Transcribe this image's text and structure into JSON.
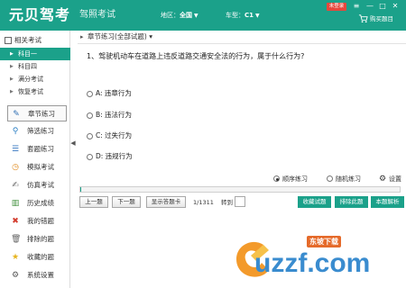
{
  "header": {
    "logo": "元贝驾考",
    "subtitle": "驾照考试",
    "region_label": "地区：",
    "region_value": "全国",
    "car_label": "车型：",
    "car_value": "C1",
    "badge": "未登录",
    "cart_label": "购买题目",
    "colors": {
      "primary": "#1ba18a",
      "badge": "#e6473c"
    }
  },
  "sidebar": {
    "tree_title": "相关考试",
    "tree_items": [
      {
        "label": "科目一",
        "selected": true
      },
      {
        "label": "科目四",
        "selected": false
      },
      {
        "label": "满分考试",
        "selected": false
      },
      {
        "label": "恢复考试",
        "selected": false
      }
    ],
    "menu": [
      {
        "label": "章节练习",
        "icon": "pencil-icon",
        "active": true
      },
      {
        "label": "筛选练习",
        "icon": "magnifier-icon",
        "active": false
      },
      {
        "label": "套题练习",
        "icon": "list-icon",
        "active": false
      },
      {
        "label": "模拟考试",
        "icon": "clock-icon",
        "active": false
      },
      {
        "label": "仿真考试",
        "icon": "pen-icon",
        "active": false
      },
      {
        "label": "历史成绩",
        "icon": "chart-icon",
        "active": false
      },
      {
        "label": "我的错题",
        "icon": "cross-icon",
        "active": false
      },
      {
        "label": "排除的题",
        "icon": "trash-icon",
        "active": false
      },
      {
        "label": "收藏的题",
        "icon": "star-icon",
        "active": false
      },
      {
        "label": "系统设置",
        "icon": "gear-icon",
        "active": false
      }
    ]
  },
  "main": {
    "breadcrumb": "章节练习(全部试题)",
    "question": "1、驾驶机动车在道路上违反道路交通安全法的行为，属于什么行为?",
    "options": [
      "A: 违章行为",
      "B: 违法行为",
      "C: 过失行为",
      "D: 违规行为"
    ],
    "modes": [
      {
        "label": "顺序练习",
        "selected": true
      },
      {
        "label": "随机练习",
        "selected": false
      }
    ],
    "settings_label": "设置",
    "progress": 0.0008,
    "buttons": {
      "prev": "上一题",
      "next": "下一题",
      "card": "显示答题卡",
      "page": "1/1311",
      "goto": "转到",
      "collect": "收藏试题",
      "exclude": "排除此题",
      "explain": "本题解析"
    }
  },
  "watermark": {
    "sub": "东坡下载",
    "main": "uzzf.com"
  }
}
